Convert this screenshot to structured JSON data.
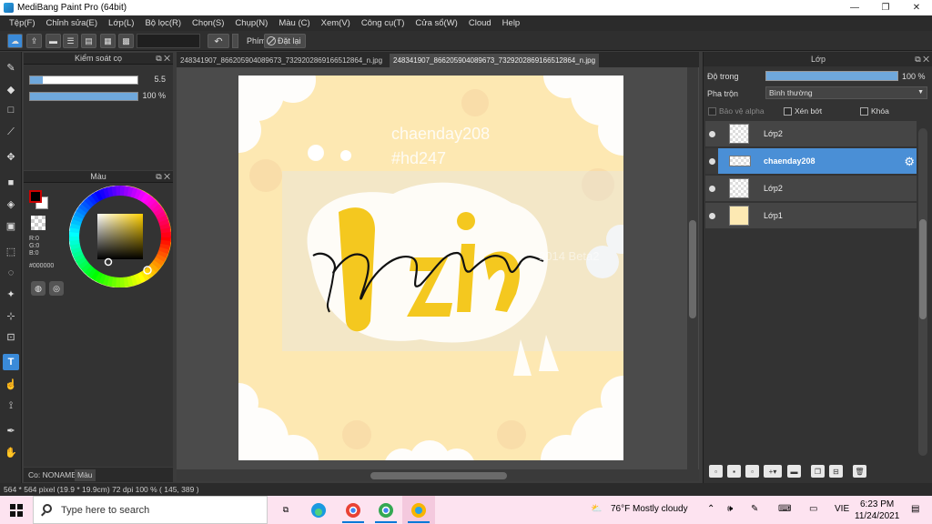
{
  "window": {
    "title": "MediBang Paint Pro (64bit)",
    "controls": [
      "—",
      "❐",
      "✕"
    ]
  },
  "menu": [
    "Tệp(F)",
    "Chỉnh sửa(E)",
    "Lớp(L)",
    "Bộ lọc(R)",
    "Chọn(S)",
    "Chụp(N)",
    "Màu (C)",
    "Xem(V)",
    "Công cụ(T)",
    "Cửa sổ(W)",
    "Cloud",
    "Help"
  ],
  "toolbar": {
    "phim_label": "Phím",
    "reset_label": "Đặt lại"
  },
  "brush_panel": {
    "title": "Kiểm soát cọ",
    "size_value": "5.5",
    "size_fraction": 0.05,
    "opacity_value": "100 %",
    "opacity_fraction": 1.0
  },
  "color_panel": {
    "title": "Màu",
    "rgb": "R:0\nG:0\nB:0",
    "hex": "#000000",
    "fg_color": "#000000",
    "bg_color": "#ffffff"
  },
  "left_tabs": [
    "Co: NONAME",
    "Màu"
  ],
  "doc_tabs": [
    "248341907_866205904089673_7329202869166512864_n.jpg",
    "248341907_866205904089673_7329202869166512864_n.jpg"
  ],
  "layers_panel": {
    "title": "Lớp",
    "opacity_label": "Độ trong",
    "opacity_value": "100 %",
    "blend_label": "Pha trộn",
    "blend_value": "Bình thường",
    "alpha_label": "Bảo vệ alpha",
    "clip_label": "Xén bớt",
    "lock_label": "Khóa",
    "layers": [
      {
        "name": "Lớp2",
        "selected": false
      },
      {
        "name": "chaenday208",
        "selected": true
      },
      {
        "name": "Lớp2",
        "selected": false
      },
      {
        "name": "Lớp1",
        "selected": false
      }
    ]
  },
  "status": {
    "text": "564 * 564 pixel   (19.9 * 19.9cm)   72 dpi   100 %   ( 145, 389 )"
  },
  "taskbar": {
    "search_placeholder": "Type here to search",
    "weather": "76°F  Mostly cloudy",
    "lang": "VIE",
    "time": "6:23 PM",
    "date": "11/24/2021"
  },
  "artwork": {
    "watermark_line1": "chaenday208",
    "watermark_line2": "#hd247",
    "ghost_text": "2014 Beta2",
    "handwriting": "gzin"
  }
}
